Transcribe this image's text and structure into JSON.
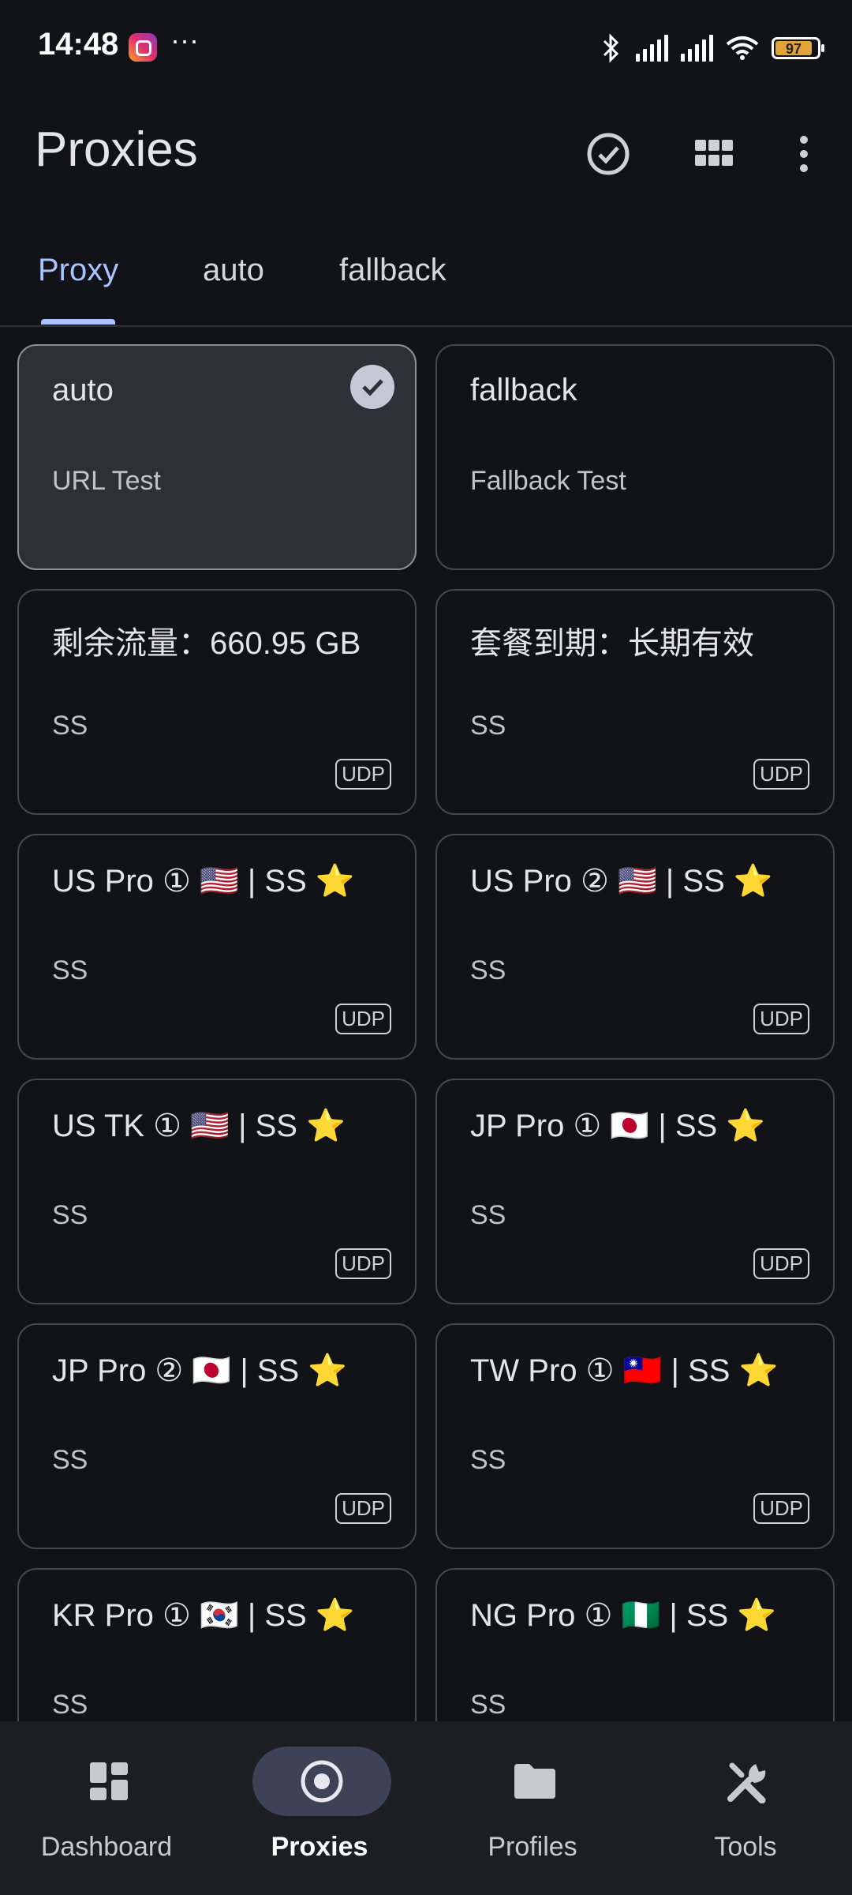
{
  "status_bar": {
    "time": "14:48",
    "more": "···",
    "battery": "97"
  },
  "app_bar": {
    "title": "Proxies"
  },
  "tabs": [
    {
      "label": "Proxy",
      "active": true
    },
    {
      "label": "auto",
      "active": false
    },
    {
      "label": "fallback",
      "active": false
    }
  ],
  "cards": [
    {
      "name": "auto",
      "type": "URL Test",
      "selected": true
    },
    {
      "name": "fallback",
      "type": "Fallback Test"
    },
    {
      "name": "剩余流量：660.95 GB",
      "type": "SS",
      "badge": "UDP"
    },
    {
      "name": "套餐到期：长期有效",
      "type": "SS",
      "badge": "UDP"
    },
    {
      "name": "US Pro ① 🇺🇸 | SS ⭐",
      "type": "SS",
      "badge": "UDP"
    },
    {
      "name": "US Pro ② 🇺🇸 | SS ⭐",
      "type": "SS",
      "badge": "UDP"
    },
    {
      "name": "US TK ① 🇺🇸 | SS ⭐",
      "type": "SS",
      "badge": "UDP"
    },
    {
      "name": "JP Pro ① 🇯🇵 | SS ⭐",
      "type": "SS",
      "badge": "UDP"
    },
    {
      "name": "JP Pro ② 🇯🇵 | SS ⭐",
      "type": "SS",
      "badge": "UDP"
    },
    {
      "name": "TW Pro ① 🇹🇼 | SS ⭐",
      "type": "SS",
      "badge": "UDP"
    },
    {
      "name": "KR Pro ① 🇰🇷  | SS ⭐",
      "type": "SS"
    },
    {
      "name": "NG Pro ① 🇳🇬 | SS ⭐",
      "type": "SS"
    }
  ],
  "nav": [
    {
      "label": "Dashboard",
      "icon": "dashboard-icon"
    },
    {
      "label": "Proxies",
      "icon": "proxies-icon",
      "active": true
    },
    {
      "label": "Profiles",
      "icon": "folder-icon"
    },
    {
      "label": "Tools",
      "icon": "tools-icon"
    }
  ],
  "colors": {
    "background": "#121318",
    "accent": "#a9c3ff",
    "nav_background": "#1d1e24",
    "nav_pill": "#3d4257"
  }
}
